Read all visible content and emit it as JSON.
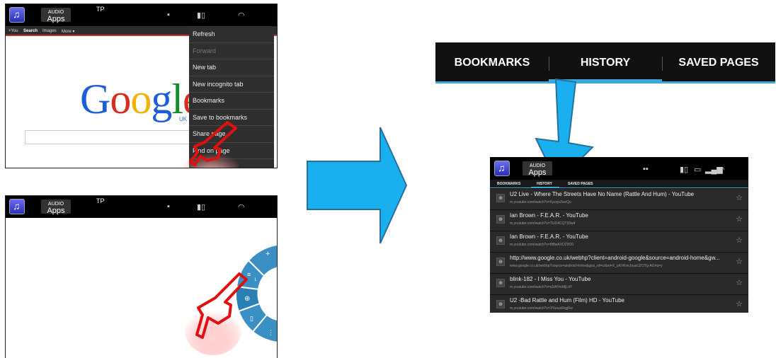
{
  "statusbar": {
    "audio_label": "AUDIO",
    "apps_label": "Apps",
    "tp_label": "TP"
  },
  "google_tabs": [
    "+You",
    "Search",
    "Images",
    "More ▾"
  ],
  "google": {
    "logo": [
      "G",
      "o",
      "o",
      "g",
      "l",
      "e"
    ],
    "logo_colors": [
      "#1a5fd6",
      "#d62d20",
      "#f2b200",
      "#1a5fd6",
      "#138c2b",
      "#d62d20"
    ],
    "region": "UK"
  },
  "menu": {
    "items": [
      {
        "label": "Refresh",
        "disabled": false
      },
      {
        "label": "Forward",
        "disabled": true
      },
      {
        "label": "New tab",
        "disabled": false
      },
      {
        "label": "New incognito tab",
        "disabled": false
      },
      {
        "label": "Bookmarks",
        "disabled": false
      },
      {
        "label": "Save to bookmarks",
        "disabled": false
      },
      {
        "label": "Share page",
        "disabled": false
      },
      {
        "label": "Find on page",
        "disabled": false
      }
    ]
  },
  "pie": {
    "badge": "1"
  },
  "tabs": {
    "items": [
      "BOOKMARKS",
      "HISTORY",
      "SAVED PAGES"
    ],
    "active": "HISTORY",
    "accent": "#3aa8d8"
  },
  "history": {
    "tabs": [
      "BOOKMARKS",
      "HISTORY",
      "SAVED PAGES"
    ],
    "rows": [
      {
        "title": "U2 Live - Where The Streets Have No Name (Rattle And Hum) - YouTube",
        "url": "m.youtube.com/watch?v=6yzojvZwzQo"
      },
      {
        "title": "Ian Brown - F.E.A.R. - YouTube",
        "url": "m.youtube.com/watch?v=TUD4CQT33w4"
      },
      {
        "title": "Ian Brown - F.E.A.R. - YouTube",
        "url": "m.youtube.com/watch?v=8f8wAXDZ9O0"
      },
      {
        "title": "http://www.google.co.uk/webhp?client=android-google&source=android-home&gw...",
        "url": "www.google.co.uk/webhp?source=android-home&gws_rd=cr&ei=X_uKVKveJousUZOTg-AG#q=y"
      },
      {
        "title": "blink-182 - I Miss You - YouTube",
        "url": "m.youtube.com/watch?v=s1tAYmMjLdY"
      },
      {
        "title": "U2 -Bad Rattle and Hum (Film) HD - YouTube",
        "url": "m.youtube.com/watch?v=3YusuxRqg5w"
      }
    ]
  },
  "colors": {
    "arrow": "#1ab0ef",
    "arrow_stroke": "#2a6f9a",
    "hand": "#e01010"
  }
}
